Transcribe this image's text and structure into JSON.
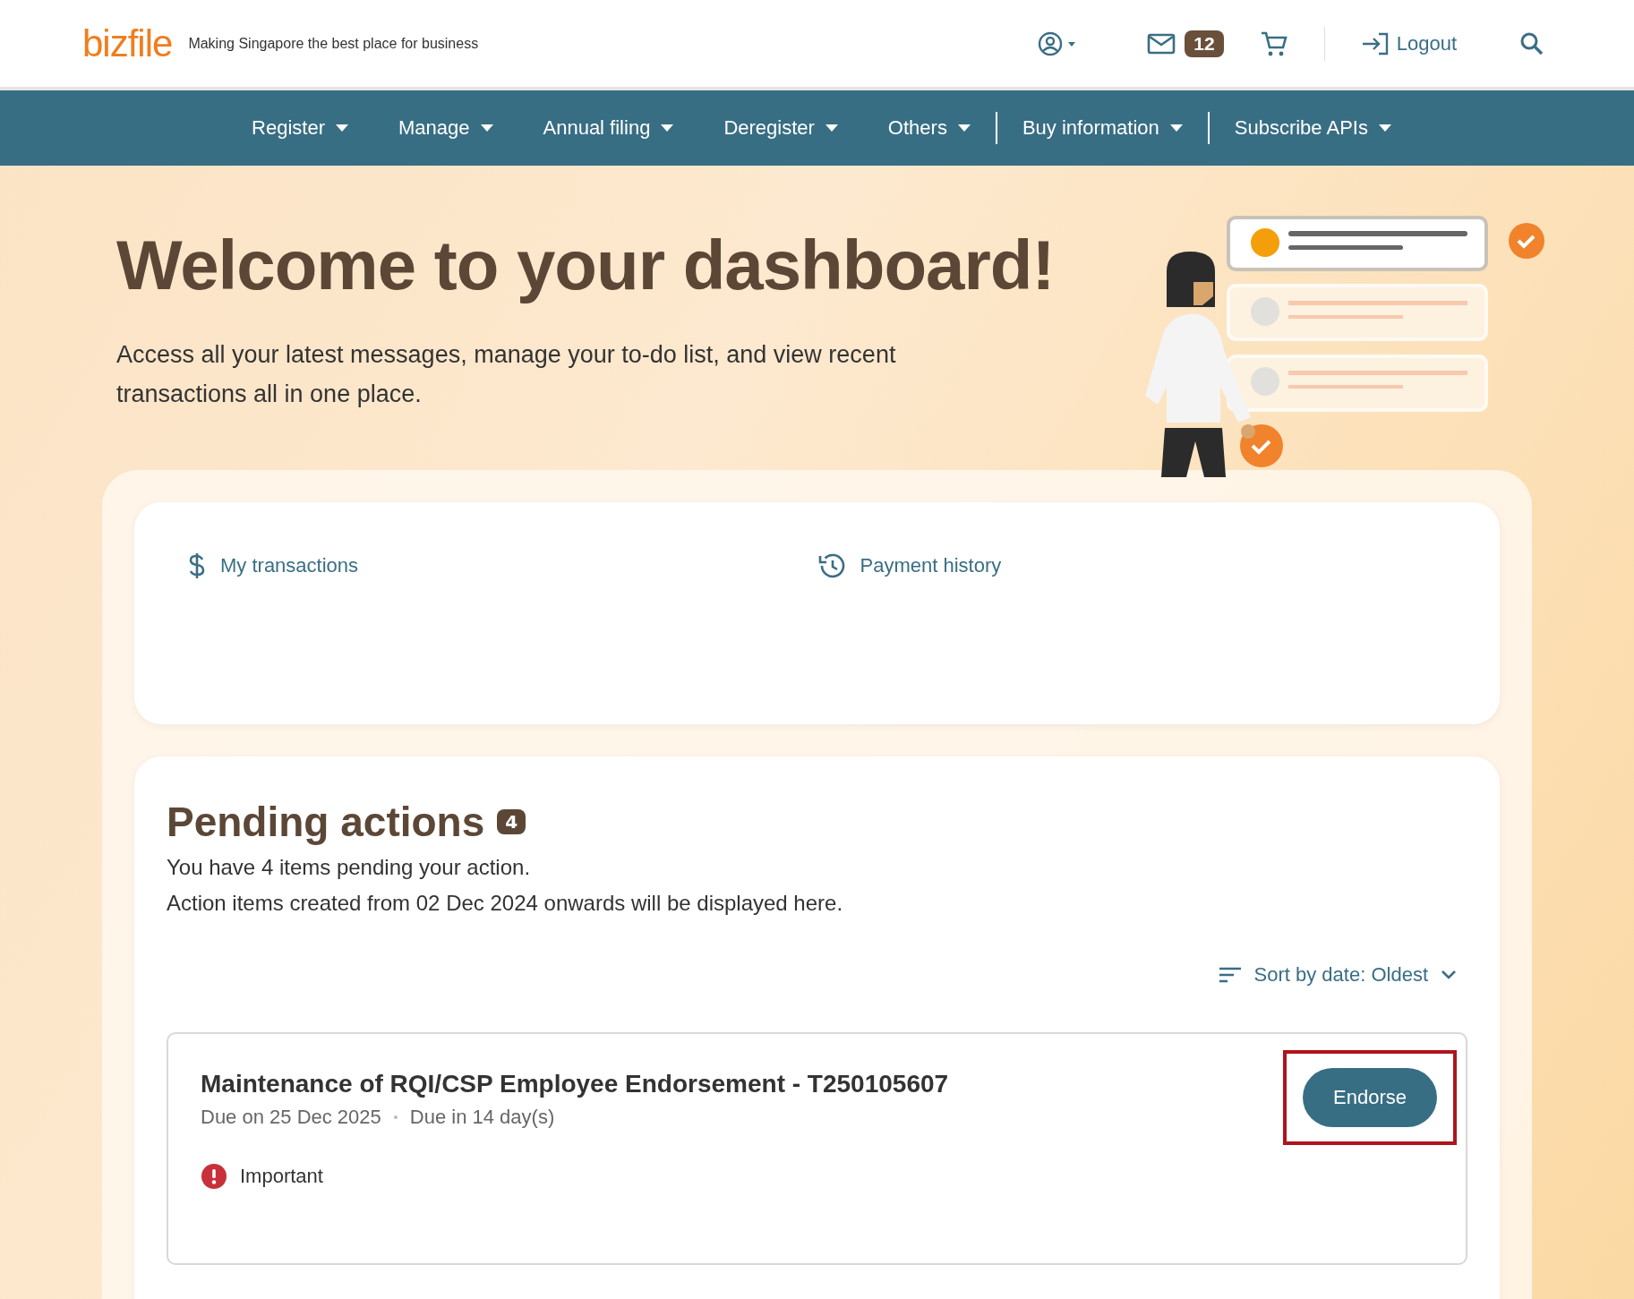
{
  "header": {
    "logo": "bizfile",
    "tagline": "Making Singapore the best place for business",
    "mail_count": "12",
    "logout": "Logout"
  },
  "nav": [
    {
      "label": "Register",
      "divider_before": false
    },
    {
      "label": "Manage",
      "divider_before": false
    },
    {
      "label": "Annual filing",
      "divider_before": false
    },
    {
      "label": "Deregister",
      "divider_before": false
    },
    {
      "label": "Others",
      "divider_before": false
    },
    {
      "label": "Buy information",
      "divider_before": true
    },
    {
      "label": "Subscribe APIs",
      "divider_before": true
    }
  ],
  "hero": {
    "title": "Welcome to your dashboard!",
    "description": "Access all your latest messages, manage your to-do list, and view recent transactions all in one place."
  },
  "links": [
    {
      "kind": "dollar",
      "label": "My transactions"
    },
    {
      "kind": "history",
      "label": "Payment history"
    }
  ],
  "pending": {
    "title": "Pending actions",
    "count": "4",
    "lines": [
      "You have 4 items pending your action.",
      "Action items created from 02 Dec 2024 onwards will be displayed here."
    ],
    "sort": "Sort by date: Oldest",
    "items": [
      {
        "title": "Maintenance of RQI/CSP Employee Endorsement - T250105607",
        "due_on": "Due on 25 Dec 2025",
        "due_in": "Due in 14 day(s)",
        "tag": "Important",
        "action": "Endorse",
        "highlighted": true
      }
    ]
  }
}
